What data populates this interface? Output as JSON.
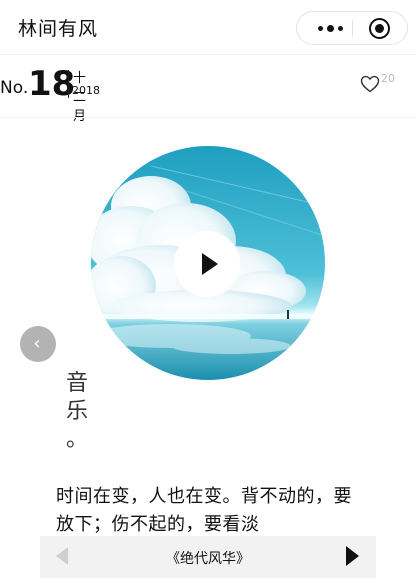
{
  "header": {
    "app_title": "林间有风",
    "more_icon": "more-dots-icon",
    "close_icon": "target-circle-icon"
  },
  "issue": {
    "no_label": "No.",
    "number": "18",
    "month": "十二月",
    "year": "2018"
  },
  "like": {
    "icon": "heart-icon",
    "count": "20"
  },
  "media": {
    "cover_icon": "album-cover",
    "play_icon": "play-icon",
    "prev_icon": "chevron-left-icon"
  },
  "category": {
    "chars": [
      "音",
      "乐",
      "。"
    ]
  },
  "quote": {
    "text": "时间在变，人也在变。背不动的，要放下；伤不起的，要看淡"
  },
  "player": {
    "song_title": "《绝代风华》",
    "prev_icon": "prev-triangle-icon",
    "next_icon": "next-triangle-icon"
  },
  "colors": {
    "background": "#ffffff",
    "text": "#111111",
    "muted": "#bbbbbb",
    "player_bg": "#f2f2f2",
    "prev_circle": "#b3b3b3"
  }
}
